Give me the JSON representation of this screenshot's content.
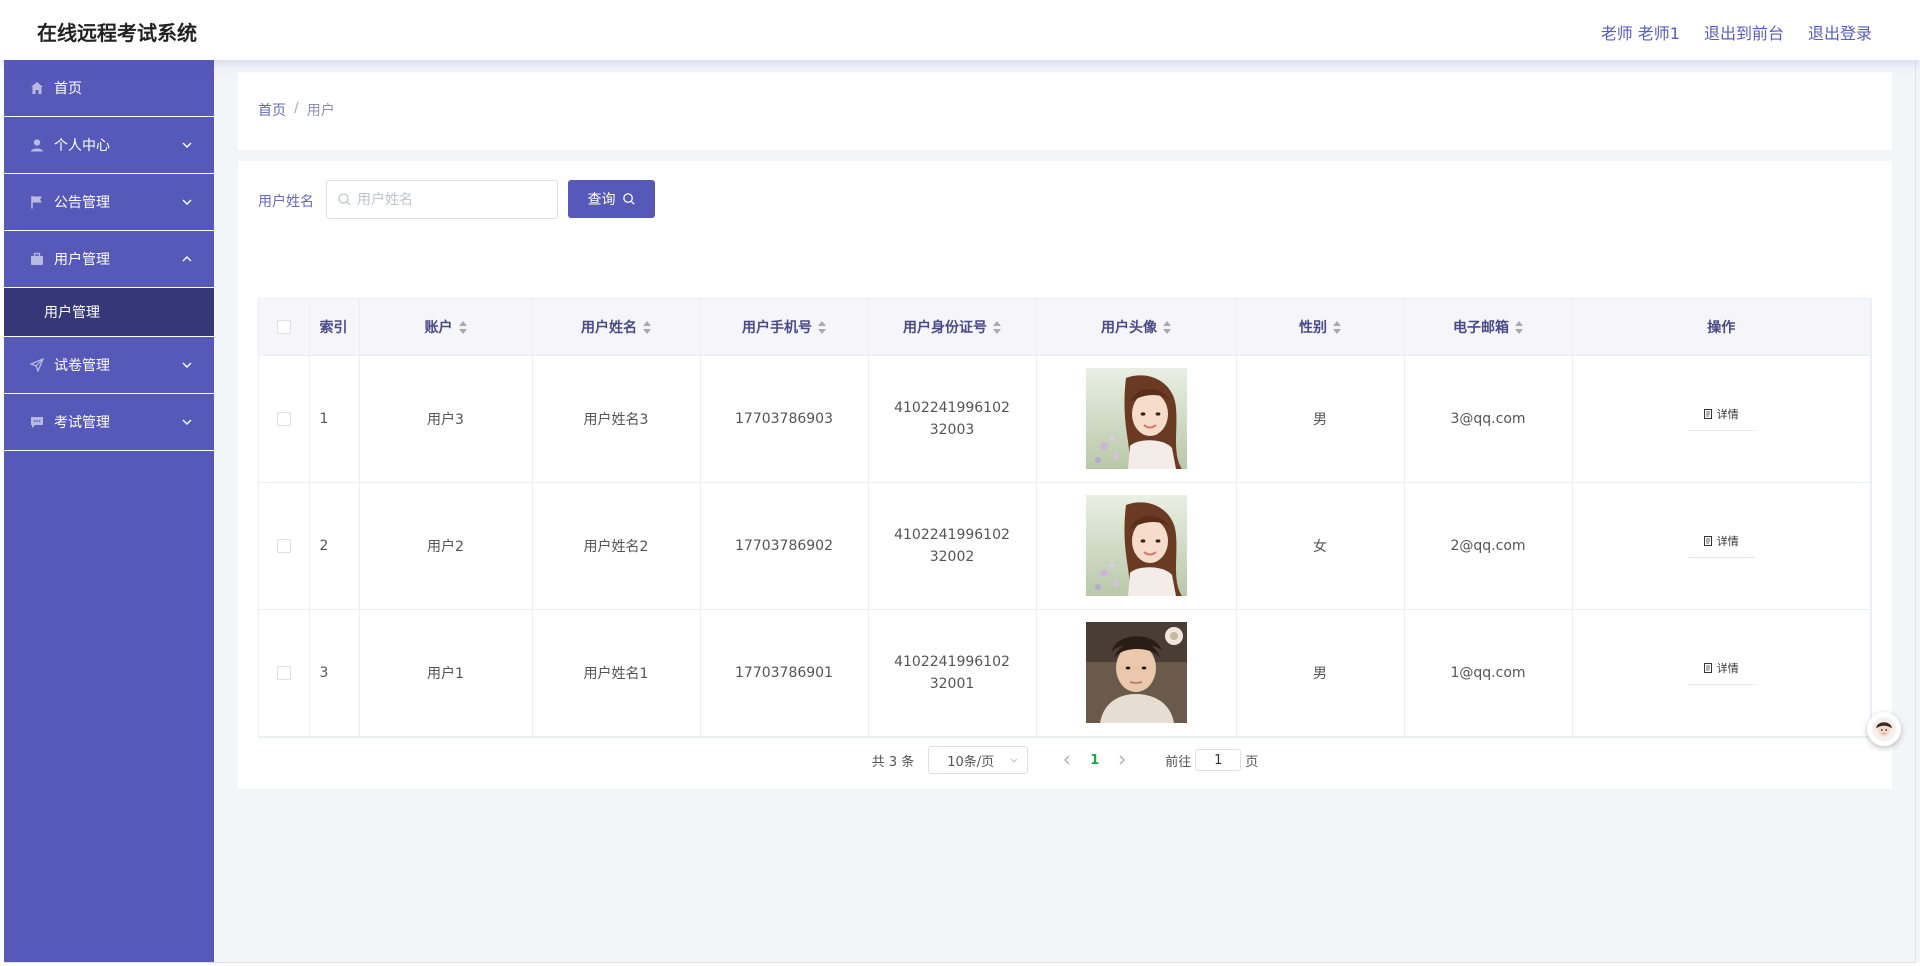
{
  "app": {
    "title": "在线远程考试系统"
  },
  "header": {
    "user": "老师 老师1",
    "to_front": "退出到前台",
    "logout": "退出登录"
  },
  "sidebar": {
    "items": [
      {
        "label": "首页",
        "icon": "home-icon"
      },
      {
        "label": "个人中心",
        "icon": "person-icon"
      },
      {
        "label": "公告管理",
        "icon": "flag-icon"
      },
      {
        "label": "用户管理",
        "icon": "briefcase-icon",
        "expanded": true
      },
      {
        "label": "试卷管理",
        "icon": "send-icon"
      },
      {
        "label": "考试管理",
        "icon": "chat-icon"
      }
    ],
    "submenu": {
      "label": "用户管理"
    }
  },
  "breadcrumb": {
    "home": "首页",
    "sep": "/",
    "current": "用户"
  },
  "search": {
    "label": "用户姓名",
    "placeholder": "用户姓名",
    "value": "",
    "button": "查询"
  },
  "table": {
    "columns": {
      "index": "索引",
      "account": "账户",
      "name": "用户姓名",
      "phone": "用户手机号",
      "idcard": "用户身份证号",
      "avatar": "用户头像",
      "gender": "性别",
      "email": "电子邮箱",
      "ops": "操作"
    },
    "rows": [
      {
        "index": "1",
        "account": "用户3",
        "name": "用户姓名3",
        "phone": "17703786903",
        "idcard": "410224199610232003",
        "gender": "男",
        "email": "3@qq.com",
        "detail": "详情"
      },
      {
        "index": "2",
        "account": "用户2",
        "name": "用户姓名2",
        "phone": "17703786902",
        "idcard": "410224199610232002",
        "gender": "女",
        "email": "2@qq.com",
        "detail": "详情"
      },
      {
        "index": "3",
        "account": "用户1",
        "name": "用户姓名1",
        "phone": "17703786901",
        "idcard": "410224199610232001",
        "gender": "男",
        "email": "1@qq.com",
        "detail": "详情"
      }
    ]
  },
  "pagination": {
    "total": "共 3 条",
    "page_size": "10条/页",
    "current_page": "1",
    "goto_prefix": "前往",
    "goto_value": "1",
    "goto_suffix": "页"
  },
  "colors": {
    "primary": "#5759b8",
    "submenu_bg": "#363777",
    "active_page": "#19a94a"
  }
}
